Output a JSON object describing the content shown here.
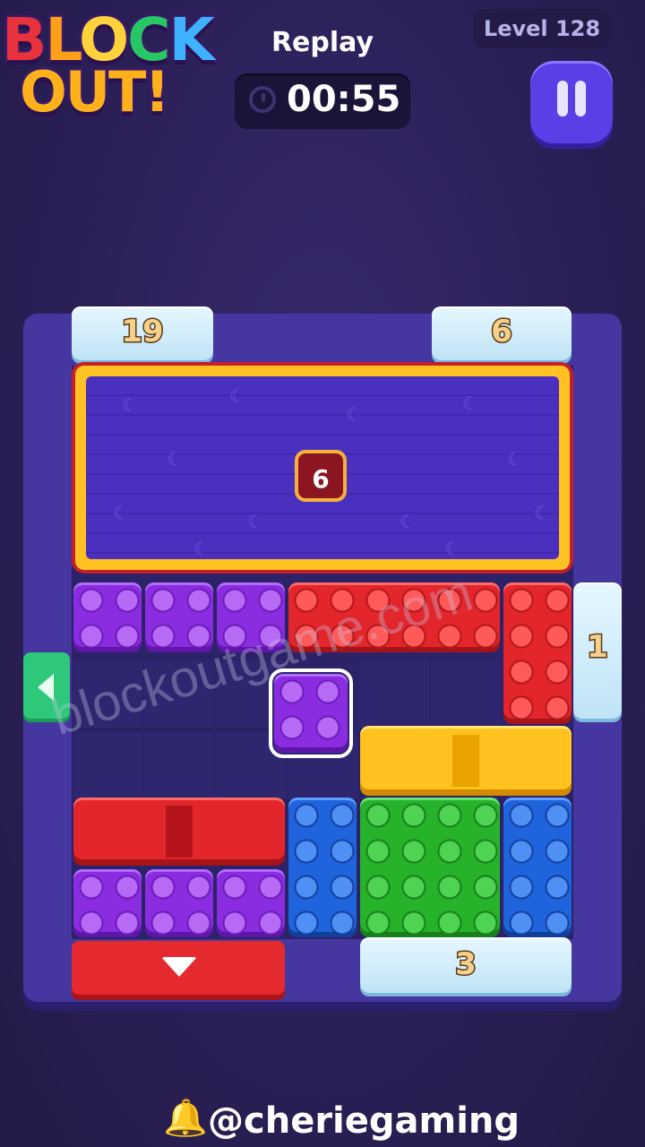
{
  "logo": {
    "line1_letters": [
      "B",
      "L",
      "O",
      "C",
      "K"
    ],
    "line2": "OUT!"
  },
  "header": {
    "mode": "Replay",
    "timer": "00:55",
    "level": "Level 128"
  },
  "board": {
    "gates": {
      "top_left": "19",
      "top_right": "6",
      "right": "1",
      "bottom_right": "3"
    },
    "mystery_block": {
      "count": "6"
    }
  },
  "watermark": "blockoutgame.com",
  "credit": "@cheriegaming",
  "icons": [
    "clock-icon",
    "pause-icon",
    "left-arrow-icon",
    "down-arrow-icon",
    "up-down-arrow-icon",
    "bell-icon"
  ],
  "colors": {
    "purple": "#8a2ce0",
    "red": "#e2262c",
    "blue": "#1f64dc",
    "green": "#27b22c",
    "yellow": "#ffc21e",
    "ice": "#d8f1fb"
  }
}
